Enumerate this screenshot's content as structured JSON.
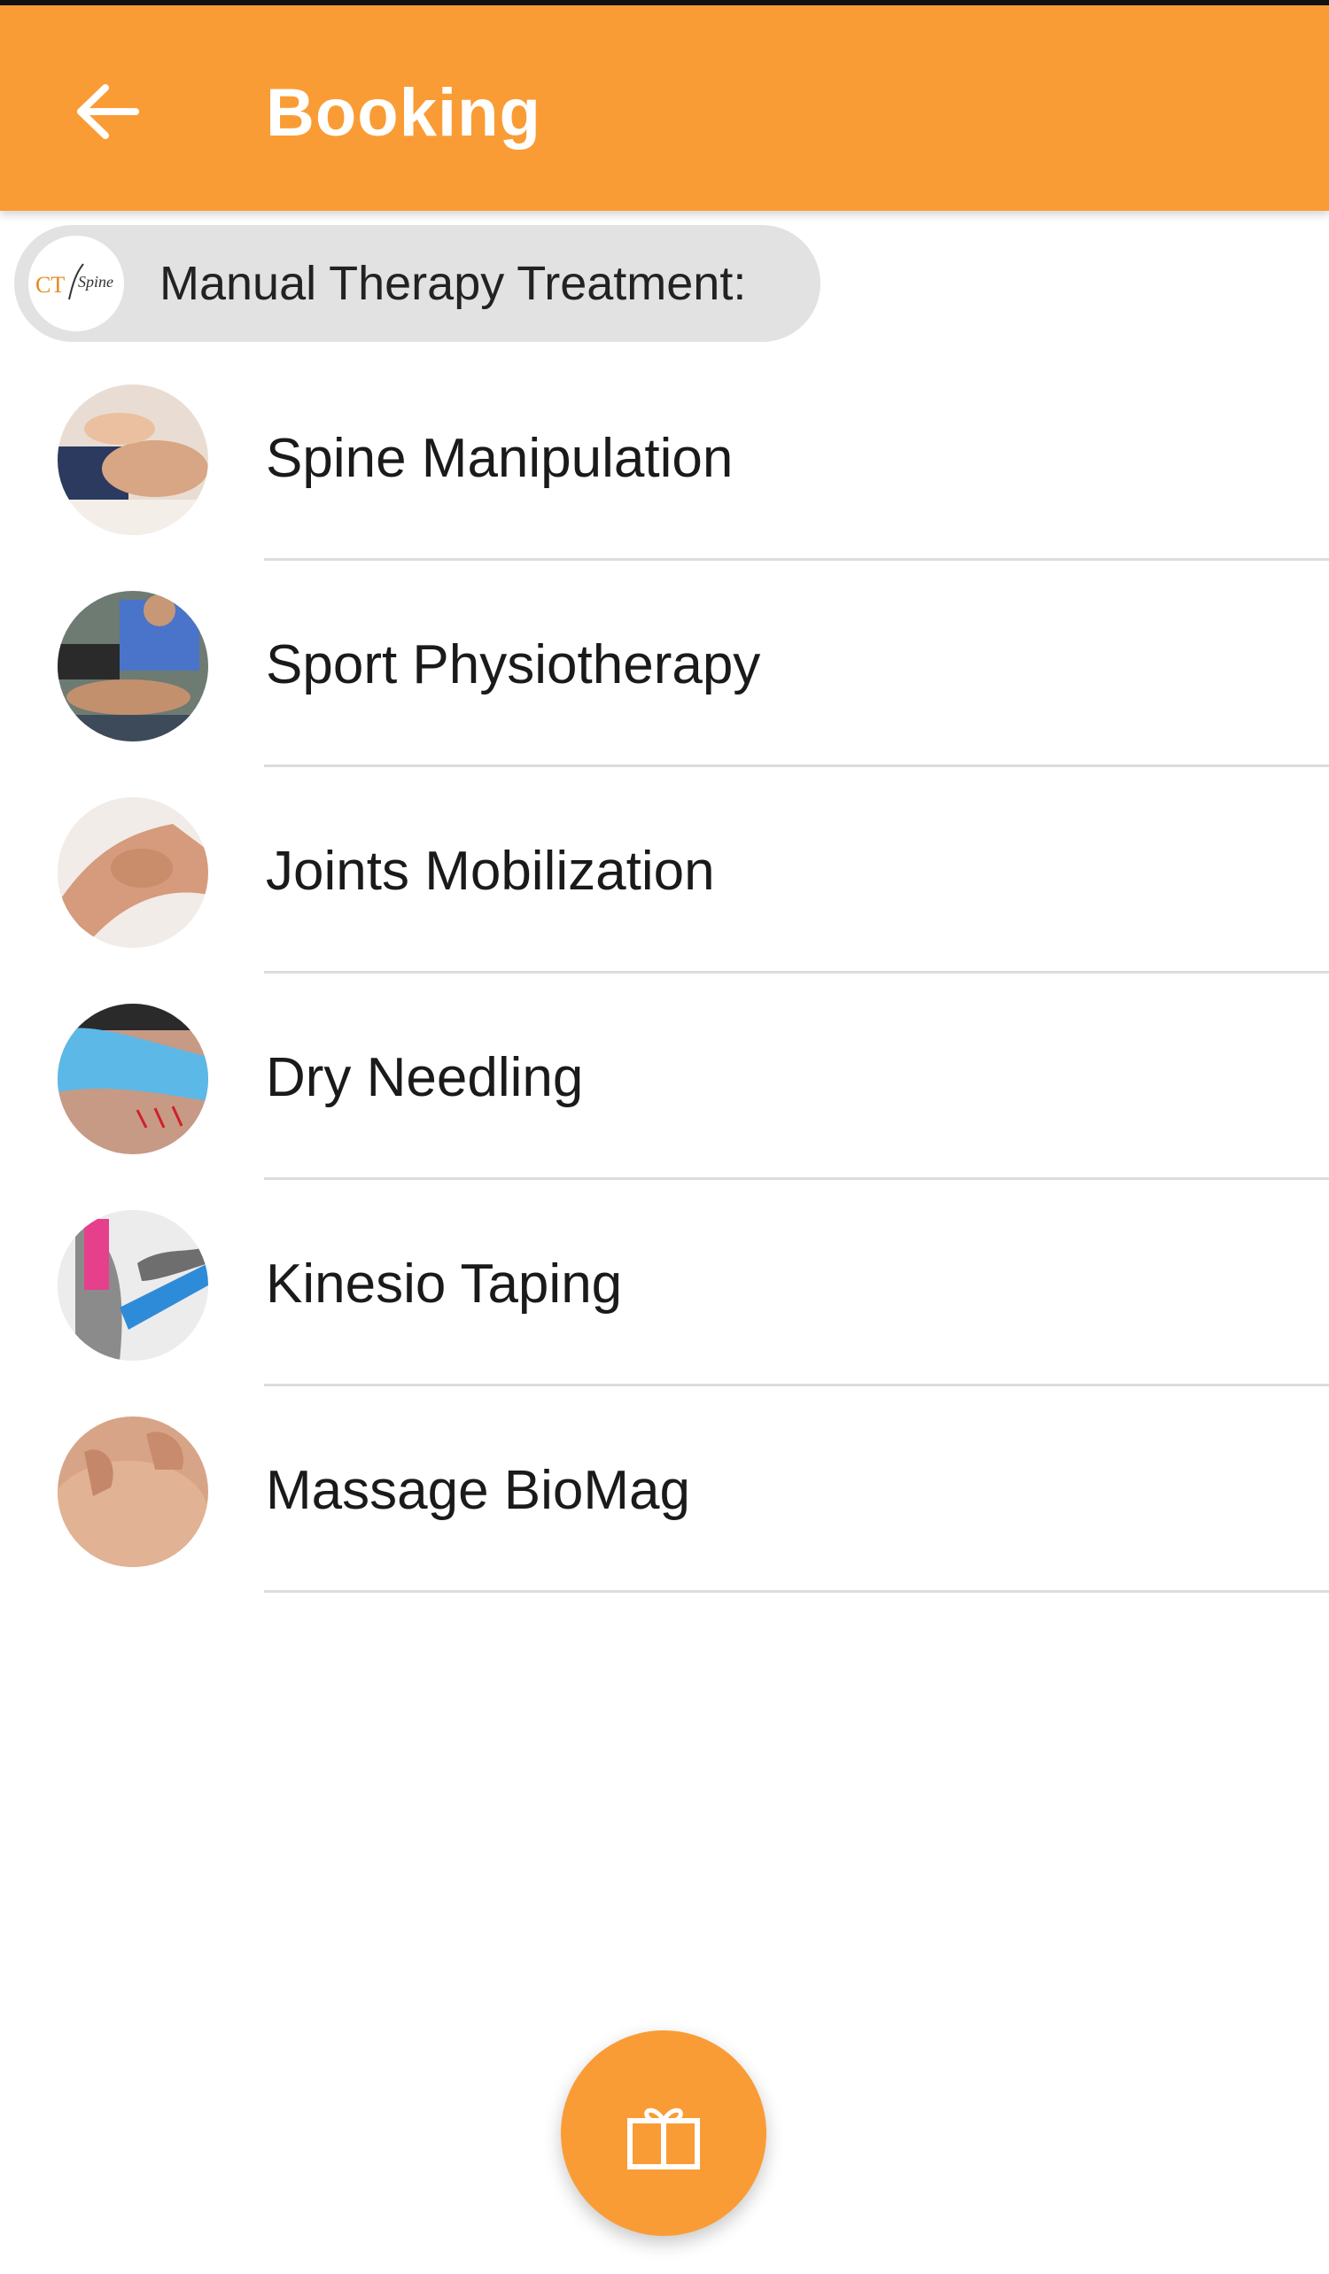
{
  "appbar": {
    "title": "Booking",
    "back_icon": "arrow-left-icon",
    "color": "#FA9C35"
  },
  "section": {
    "label": "Manual Therapy Treatment:",
    "logo_text_ct": "CT",
    "logo_text_spine": "Spine"
  },
  "treatments": [
    {
      "label": "Spine Manipulation",
      "thumb": "spine-manipulation-photo"
    },
    {
      "label": "Sport Physiotherapy",
      "thumb": "sport-physiotherapy-photo"
    },
    {
      "label": "Joints Mobilization",
      "thumb": "joints-mobilization-photo"
    },
    {
      "label": "Dry Needling",
      "thumb": "dry-needling-photo"
    },
    {
      "label": "Kinesio Taping",
      "thumb": "kinesio-taping-photo"
    },
    {
      "label": "Massage BioMag",
      "thumb": "massage-biomag-photo"
    }
  ],
  "fab": {
    "icon": "gift-icon"
  }
}
